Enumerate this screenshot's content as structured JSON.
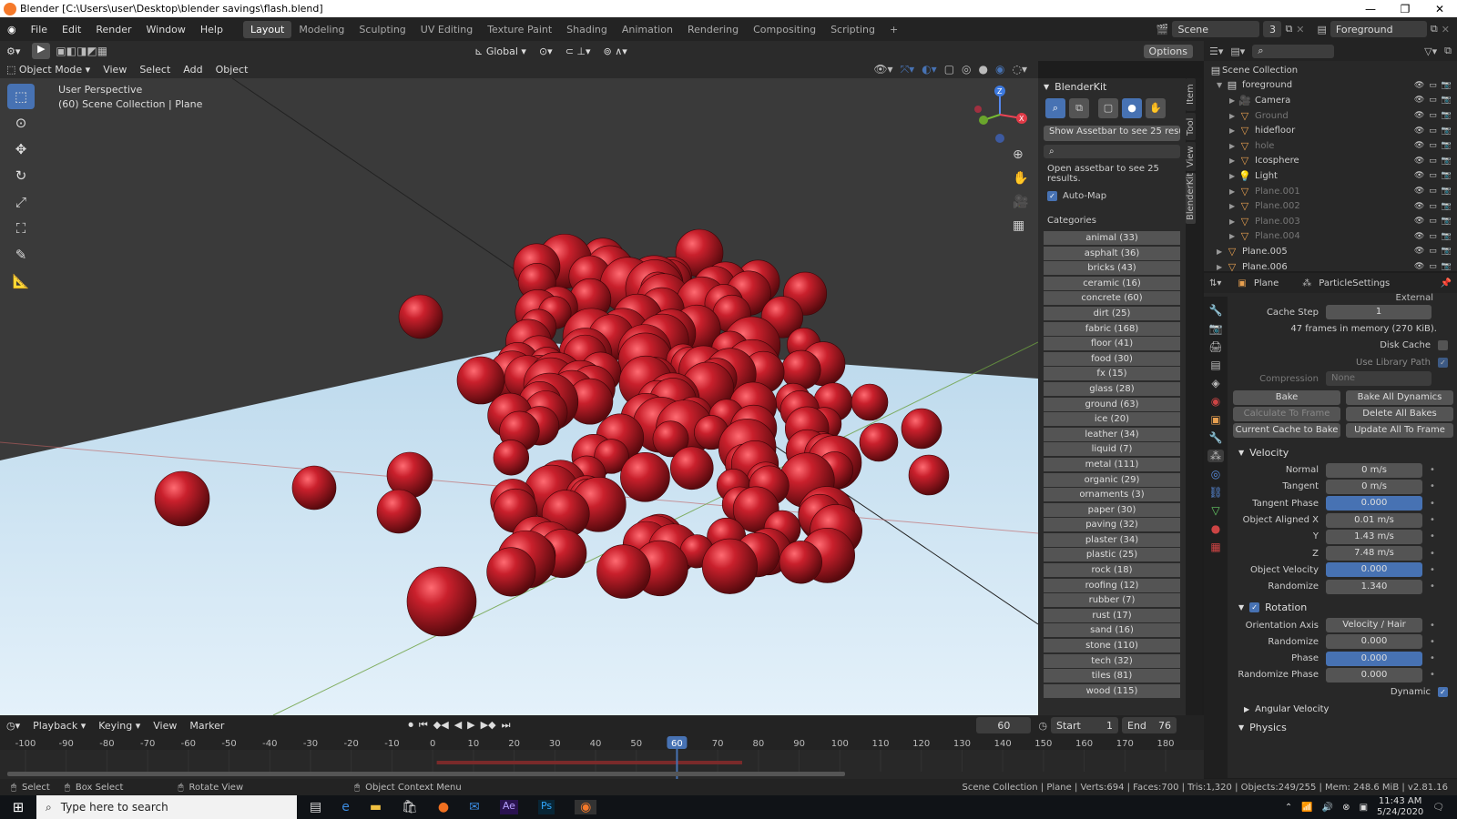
{
  "window": {
    "title": "Blender [C:\\Users\\user\\Desktop\\blender savings\\flash.blend]",
    "controls": [
      "—",
      "❐",
      "✕"
    ]
  },
  "menu": [
    "File",
    "Edit",
    "Render",
    "Window",
    "Help"
  ],
  "workspaces": [
    "Layout",
    "Modeling",
    "Sculpting",
    "UV Editing",
    "Texture Paint",
    "Shading",
    "Animation",
    "Rendering",
    "Compositing",
    "Scripting"
  ],
  "active_workspace": "Layout",
  "scene": {
    "name": "Scene",
    "count": "3",
    "view_layer": "Foreground"
  },
  "viewport_header": {
    "mode": "Object Mode",
    "menus": [
      "View",
      "Select",
      "Add",
      "Object"
    ],
    "orientation": "Global",
    "options": "Options"
  },
  "viewport": {
    "perspective": "User Perspective",
    "collection": "(60) Scene Collection | Plane"
  },
  "tools": [
    "select-box",
    "cursor",
    "move",
    "rotate",
    "scale",
    "transform",
    "annotate",
    "measure"
  ],
  "blenderkit": {
    "title": "BlenderKit",
    "show_assetbar": "Show Assetbar to see 25 result...",
    "search_placeholder": "",
    "open_text": "Open assetbar to see 25 results.",
    "automap": "Auto-Map",
    "categories_title": "Categories",
    "categories": [
      "animal (33)",
      "asphalt (36)",
      "bricks (43)",
      "ceramic (16)",
      "concrete (60)",
      "dirt (25)",
      "fabric (168)",
      "floor (41)",
      "food (30)",
      "fx (15)",
      "glass (28)",
      "ground (63)",
      "ice (20)",
      "leather (34)",
      "liquid (7)",
      "metal (111)",
      "organic (29)",
      "ornaments (3)",
      "paper (30)",
      "paving (32)",
      "plaster (34)",
      "plastic (25)",
      "rock (18)",
      "roofing (12)",
      "rubber (7)",
      "rust (17)",
      "sand (16)",
      "stone (110)",
      "tech (32)",
      "tiles (81)",
      "wood (115)"
    ]
  },
  "side_tabs": [
    "Item",
    "Tool",
    "View",
    "BlenderKit"
  ],
  "outliner": {
    "root": "Scene Collection",
    "items": [
      {
        "name": "foreground",
        "indent": 1,
        "dim": false,
        "icon": "collection"
      },
      {
        "name": "Camera",
        "indent": 2,
        "dim": false,
        "icon": "camera"
      },
      {
        "name": "Ground",
        "indent": 2,
        "dim": true,
        "icon": "mesh"
      },
      {
        "name": "hidefloor",
        "indent": 2,
        "dim": false,
        "icon": "mesh"
      },
      {
        "name": "hole",
        "indent": 2,
        "dim": true,
        "icon": "mesh"
      },
      {
        "name": "Icosphere",
        "indent": 2,
        "dim": false,
        "icon": "mesh"
      },
      {
        "name": "Light",
        "indent": 2,
        "dim": false,
        "icon": "light"
      },
      {
        "name": "Plane.001",
        "indent": 2,
        "dim": true,
        "icon": "mesh"
      },
      {
        "name": "Plane.002",
        "indent": 2,
        "dim": true,
        "icon": "mesh"
      },
      {
        "name": "Plane.003",
        "indent": 2,
        "dim": true,
        "icon": "mesh"
      },
      {
        "name": "Plane.004",
        "indent": 2,
        "dim": true,
        "icon": "mesh"
      },
      {
        "name": "Plane.005",
        "indent": 1,
        "dim": false,
        "icon": "mesh"
      },
      {
        "name": "Plane.006",
        "indent": 1,
        "dim": false,
        "icon": "mesh"
      }
    ]
  },
  "properties": {
    "object": "Plane",
    "settings": "ParticleSettings",
    "external": "External",
    "cache_step_label": "Cache Step",
    "cache_step": "1",
    "memory": "47 frames in memory (270 KiB).",
    "disk_cache": "Disk Cache",
    "use_library_path": "Use Library Path",
    "compression_label": "Compression",
    "compression": "None",
    "buttons": [
      "Bake",
      "Bake All Dynamics",
      "Calculate To Frame",
      "Delete All Bakes",
      "Current Cache to Bake",
      "Update All To Frame"
    ],
    "velocity_title": "Velocity",
    "velocity": [
      {
        "label": "Normal",
        "value": "0 m/s",
        "blue": false
      },
      {
        "label": "Tangent",
        "value": "0 m/s",
        "blue": false
      },
      {
        "label": "Tangent Phase",
        "value": "0.000",
        "blue": true
      },
      {
        "label": "Object Aligned X",
        "value": "0.01 m/s",
        "blue": false
      },
      {
        "label": "Y",
        "value": "1.43 m/s",
        "blue": false
      },
      {
        "label": "Z",
        "value": "7.48 m/s",
        "blue": false
      },
      {
        "label": "Object Velocity",
        "value": "0.000",
        "blue": true
      },
      {
        "label": "Randomize",
        "value": "1.340",
        "blue": false
      }
    ],
    "rotation_title": "Rotation",
    "rotation": [
      {
        "label": "Orientation Axis",
        "value": "Velocity / Hair",
        "blue": false
      },
      {
        "label": "Randomize",
        "value": "0.000",
        "blue": false
      },
      {
        "label": "Phase",
        "value": "0.000",
        "blue": true
      },
      {
        "label": "Randomize Phase",
        "value": "0.000",
        "blue": false
      }
    ],
    "dynamic": "Dynamic",
    "angular_velocity": "Angular Velocity",
    "physics": "Physics"
  },
  "timeline": {
    "menus": [
      "Playback",
      "Keying",
      "View",
      "Marker"
    ],
    "current_frame": "60",
    "start_label": "Start",
    "start": "1",
    "end_label": "End",
    "end": "76",
    "ticks": [
      "-100",
      "-90",
      "-80",
      "-70",
      "-60",
      "-50",
      "-40",
      "-30",
      "-20",
      "-10",
      "0",
      "10",
      "20",
      "30",
      "40",
      "50",
      "60",
      "70",
      "80",
      "90",
      "100",
      "110",
      "120",
      "130",
      "140",
      "150",
      "160",
      "170",
      "180"
    ]
  },
  "status": {
    "select": "Select",
    "box_select": "Box Select",
    "rotate_view": "Rotate View",
    "context_menu": "Object Context Menu",
    "info": "Scene Collection | Plane | Verts:694 | Faces:700 | Tris:1,320 | Objects:249/255 | Mem: 248.6 MiB | v2.81.16"
  },
  "taskbar": {
    "search_placeholder": "Type here to search",
    "time": "11:43 AM",
    "date": "5/24/2020"
  },
  "colors": {
    "accent": "#4772b3",
    "sphere": "#b0141e",
    "orange": "#f5792a"
  }
}
